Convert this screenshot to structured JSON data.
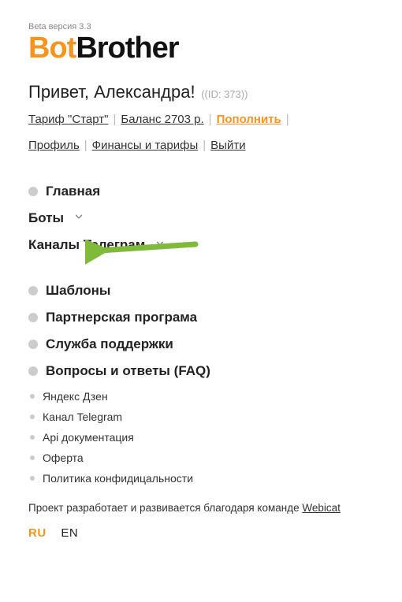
{
  "header": {
    "beta": "Beta версия 3.3",
    "logo_left": "Bot",
    "logo_right": "Brother"
  },
  "greeting": {
    "text": "Привет, Александра!",
    "id_text": " ((ID: 373))"
  },
  "links": {
    "tariff": "Тариф \"Старт\"",
    "balance": "Баланс 2703 р.",
    "topup": "Пополнить",
    "profile": "Профиль",
    "finance": "Финансы и тарифы",
    "logout": "Выйти"
  },
  "nav": {
    "main": "Главная",
    "bots": "Боты",
    "channels": "Каналы Телеграм",
    "templates": "Шаблоны",
    "partner": "Партнерская програма",
    "support": "Служба поддержки",
    "faq": "Вопросы и ответы (FAQ)"
  },
  "support_links": {
    "0": "Яндекс Дзен",
    "1": "Канал Telegram",
    "2": "Api документация",
    "3": "Оферта",
    "4": "Политика конфидицальности"
  },
  "footer": {
    "text": "Проект разработает и развивается благодаря команде ",
    "link": "Webicat"
  },
  "lang": {
    "ru": "RU",
    "en": "EN"
  }
}
